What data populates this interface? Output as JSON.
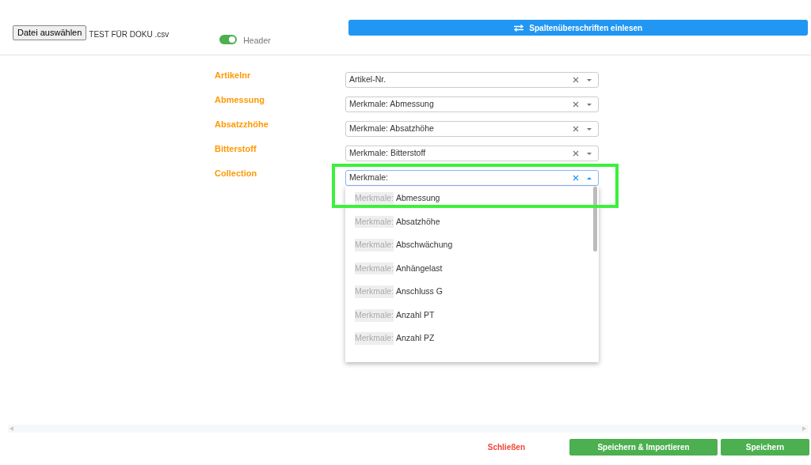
{
  "file_button": "Datei auswählen",
  "file_name": "TEST FÜR DOKU .csv",
  "header_toggle": {
    "label": "Header",
    "on": true
  },
  "read_headers_button": "Spaltenüberschriften einlesen",
  "mappings": [
    {
      "label": "Artikelnr",
      "value": "Artikel-Nr.",
      "open": false
    },
    {
      "label": "Abmessung",
      "value": "Merkmale: Abmessung",
      "open": false
    },
    {
      "label": "Absatzzhöhe",
      "value": "Merkmale: Absatzhöhe",
      "open": false
    },
    {
      "label": "Bitterstoff",
      "value": "Merkmale: Bitterstoff",
      "open": false
    },
    {
      "label": "Collection",
      "value": "Merkmale:",
      "open": true
    }
  ],
  "dropdown_options": [
    {
      "prefix": "Merkmale:",
      "text": "Abmessung"
    },
    {
      "prefix": "Merkmale:",
      "text": "Absatzhöhe"
    },
    {
      "prefix": "Merkmale:",
      "text": "Abschwächung"
    },
    {
      "prefix": "Merkmale:",
      "text": "Anhängelast"
    },
    {
      "prefix": "Merkmale:",
      "text": "Anschluss G"
    },
    {
      "prefix": "Merkmale:",
      "text": "Anzahl PT"
    },
    {
      "prefix": "Merkmale:",
      "text": "Anzahl PZ"
    }
  ],
  "footer": {
    "close": "Schließen",
    "save_import": "Speichern & Importieren",
    "save": "Speichern"
  }
}
